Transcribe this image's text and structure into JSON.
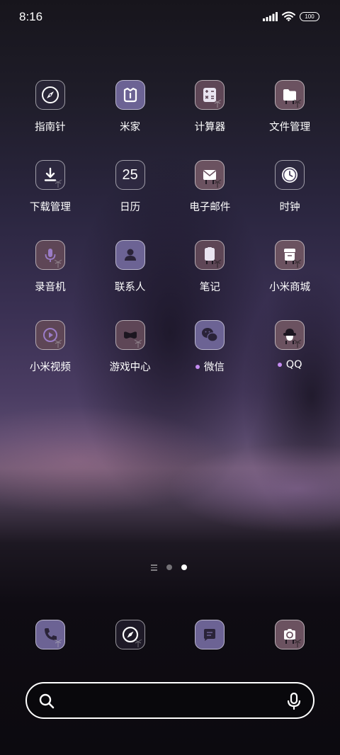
{
  "status_bar": {
    "time": "8:16",
    "battery": "100",
    "icons": [
      "signal-icon",
      "wifi-icon",
      "battery-icon"
    ]
  },
  "apps": [
    {
      "label": "指南针",
      "icon": "compass-icon",
      "notify": false
    },
    {
      "label": "米家",
      "icon": "mijia-icon",
      "notify": false
    },
    {
      "label": "计算器",
      "icon": "calculator-icon",
      "notify": false
    },
    {
      "label": "文件管理",
      "icon": "folder-icon",
      "notify": false
    },
    {
      "label": "下载管理",
      "icon": "download-icon",
      "notify": false
    },
    {
      "label": "日历",
      "icon": "calendar-icon",
      "notify": false,
      "icon_text": "25"
    },
    {
      "label": "电子邮件",
      "icon": "mail-icon",
      "notify": false
    },
    {
      "label": "时钟",
      "icon": "clock-icon",
      "notify": false
    },
    {
      "label": "录音机",
      "icon": "microphone-icon",
      "notify": false
    },
    {
      "label": "联系人",
      "icon": "contact-icon",
      "notify": false
    },
    {
      "label": "笔记",
      "icon": "notes-icon",
      "notify": false
    },
    {
      "label": "小米商城",
      "icon": "store-icon",
      "notify": false
    },
    {
      "label": "小米视频",
      "icon": "video-play-icon",
      "notify": false
    },
    {
      "label": "游戏中心",
      "icon": "game-mask-icon",
      "notify": false
    },
    {
      "label": "微信",
      "icon": "wechat-icon",
      "notify": true
    },
    {
      "label": "QQ",
      "icon": "qq-penguin-icon",
      "notify": true
    }
  ],
  "page_indicator": {
    "pages": 2,
    "active_page": 2
  },
  "dock": [
    {
      "icon": "phone-icon"
    },
    {
      "icon": "browser-compass-icon"
    },
    {
      "icon": "message-icon"
    },
    {
      "icon": "camera-icon"
    }
  ],
  "search": {
    "placeholder": "",
    "value": ""
  },
  "colors": {
    "notify_dot": "#c58cf2",
    "icon_violet": "#6c6394",
    "icon_mauve": "#5e4656"
  }
}
